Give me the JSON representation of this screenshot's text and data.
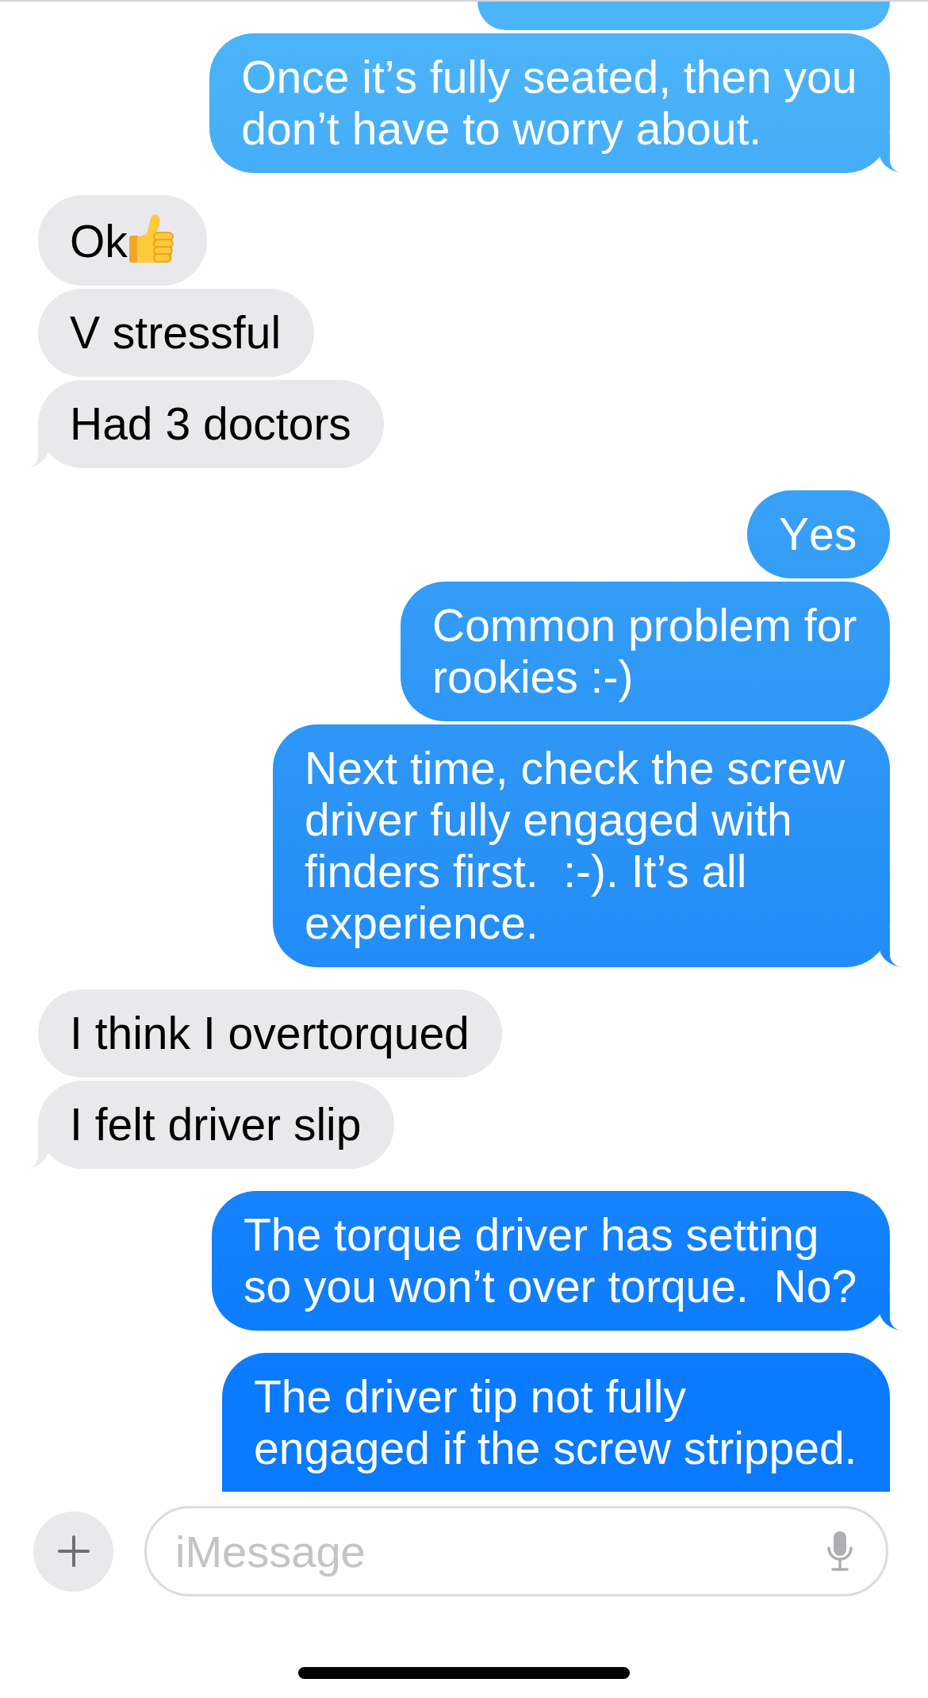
{
  "thread": {
    "messages": [
      {
        "outgoing": true,
        "kind": "fragment",
        "tail": false,
        "clipped_top": true,
        "clipped_bottom": false
      },
      {
        "outgoing": true,
        "kind": "text",
        "text": "Once it’s fully seated, then you don’t have to worry about.",
        "tail": true,
        "clipped_top": false,
        "clipped_bottom": false
      },
      {
        "outgoing": false,
        "kind": "emoji_text",
        "text": "Ok",
        "tail": false,
        "clipped_top": false,
        "clipped_bottom": false
      },
      {
        "outgoing": false,
        "kind": "text",
        "text": "V stressful",
        "tail": false,
        "clipped_top": false,
        "clipped_bottom": false
      },
      {
        "outgoing": false,
        "kind": "text",
        "text": "Had 3 doctors",
        "tail": true,
        "clipped_top": false,
        "clipped_bottom": false
      },
      {
        "outgoing": true,
        "kind": "text",
        "text": "Yes",
        "tail": false,
        "clipped_top": false,
        "clipped_bottom": false
      },
      {
        "outgoing": true,
        "kind": "text",
        "text": "Common problem for\nrookies :-)",
        "tail": false,
        "clipped_top": false,
        "clipped_bottom": false
      },
      {
        "outgoing": true,
        "kind": "text",
        "text": "Next time, check the screw driver fully engaged with finders first.  :-). It’s all experience.",
        "tail": true,
        "clipped_top": false,
        "clipped_bottom": false
      },
      {
        "outgoing": false,
        "kind": "text",
        "text": "I think I overtorqued",
        "tail": false,
        "clipped_top": false,
        "clipped_bottom": false
      },
      {
        "outgoing": false,
        "kind": "text",
        "text": "I felt driver slip",
        "tail": true,
        "clipped_top": false,
        "clipped_bottom": false
      },
      {
        "outgoing": true,
        "kind": "text",
        "text": "The torque driver has setting so you won’t over torque.  No?",
        "tail": true,
        "clipped_top": false,
        "clipped_bottom": false
      },
      {
        "outgoing": true,
        "kind": "text",
        "text": "The driver tip not fully engaged if the screw stripped.",
        "tail": false,
        "clipped_top": false,
        "clipped_bottom": true
      }
    ]
  },
  "composer": {
    "placeholder": "iMessage"
  }
}
